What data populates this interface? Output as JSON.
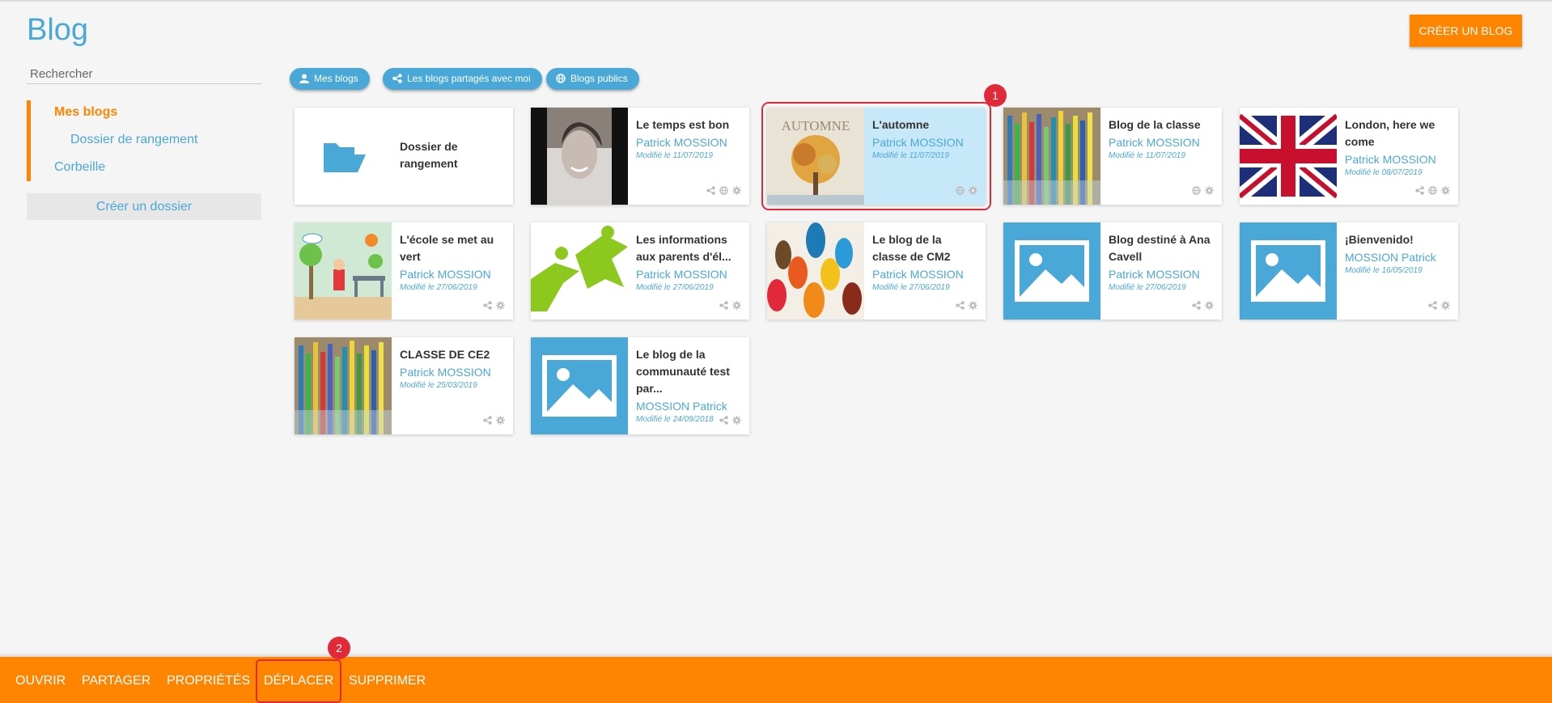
{
  "header": {
    "title": "Blog",
    "create_button": "CRÉER UN BLOG"
  },
  "sidebar": {
    "search_placeholder": "Rechercher",
    "tree": [
      {
        "label": "Mes blogs",
        "active": true
      },
      {
        "label": "Dossier de rangement"
      },
      {
        "label": "Corbeille"
      }
    ],
    "new_folder": "Créer un dossier"
  },
  "filters": [
    {
      "label": "Mes blogs",
      "icon": "user-icon"
    },
    {
      "label": "Les blogs partagés avec moi",
      "icon": "share-icon"
    },
    {
      "label": "Blogs publics",
      "icon": "globe-icon"
    }
  ],
  "folder": {
    "title": "Dossier de rangement",
    "icon": "folder-open-icon"
  },
  "blogs": [
    {
      "title": "Le temps est bon",
      "author": "Patrick MOSSION",
      "date": "Modifié le 11/07/2019",
      "thumb": "portrait-photo",
      "icons": [
        "share-icon",
        "globe-icon",
        "gear-icon"
      ]
    },
    {
      "title": "L'automne",
      "author": "Patrick MOSSION",
      "date": "Modifié le 11/07/2019",
      "thumb": "autumn-tree",
      "thumb_text": "AUTOMNE",
      "icons": [
        "globe-icon",
        "gear-icon"
      ],
      "selected": true
    },
    {
      "title": "Blog de la classe",
      "author": "Patrick MOSSION",
      "date": "Modifié le 11/07/2019",
      "thumb": "colored-pencils",
      "icons": [
        "globe-icon",
        "gear-icon"
      ]
    },
    {
      "title": "London, here we come",
      "author": "Patrick MOSSION",
      "date": "Modifié le 08/07/2019",
      "thumb": "union-jack",
      "icons": [
        "share-icon",
        "globe-icon",
        "gear-icon"
      ]
    },
    {
      "title": "L'école se met au vert",
      "author": "Patrick MOSSION",
      "date": "Modifié le 27/06/2019",
      "thumb": "green-school",
      "icons": [
        "share-icon",
        "gear-icon"
      ]
    },
    {
      "title": "Les informations aux parents d'él...",
      "author": "Patrick MOSSION",
      "date": "Modifié le 27/06/2019",
      "thumb": "green-figures",
      "icons": [
        "share-icon",
        "gear-icon"
      ]
    },
    {
      "title": "Le blog de la classe de CM2",
      "author": "Patrick MOSSION",
      "date": "Modifié le 27/06/2019",
      "thumb": "raised-hands",
      "icons": [
        "share-icon",
        "gear-icon"
      ]
    },
    {
      "title": "Blog destiné à Ana Cavell",
      "author": "Patrick MOSSION",
      "date": "Modifié le 27/06/2019",
      "thumb": "image-placeholder",
      "icons": [
        "share-icon",
        "gear-icon"
      ]
    },
    {
      "title": "¡Bienvenido!",
      "author": "MOSSION Patrick",
      "date": "Modifié le 16/05/2019",
      "thumb": "image-placeholder",
      "icons": [
        "share-icon",
        "gear-icon"
      ]
    },
    {
      "title": "CLASSE DE CE2",
      "author": "Patrick MOSSION",
      "date": "Modifié le 25/03/2019",
      "thumb": "colored-pencils",
      "icons": [
        "share-icon",
        "gear-icon"
      ]
    },
    {
      "title": "Le blog de la communauté test par...",
      "author": "MOSSION Patrick",
      "date": "Modifié le 24/09/2018",
      "thumb": "image-placeholder",
      "icons": [
        "share-icon",
        "gear-icon"
      ]
    }
  ],
  "action_bar": [
    {
      "label": "OUVRIR"
    },
    {
      "label": "PARTAGER"
    },
    {
      "label": "PROPRIÉTÉS"
    },
    {
      "label": "DÉPLACER",
      "highlight": true
    },
    {
      "label": "SUPPRIMER"
    }
  ],
  "annotations": [
    "1",
    "2"
  ],
  "colors": {
    "accent": "#ff8500",
    "primary": "#4aa8d8",
    "highlight": "#e2293a",
    "selected_bg": "#c6e8f9"
  }
}
